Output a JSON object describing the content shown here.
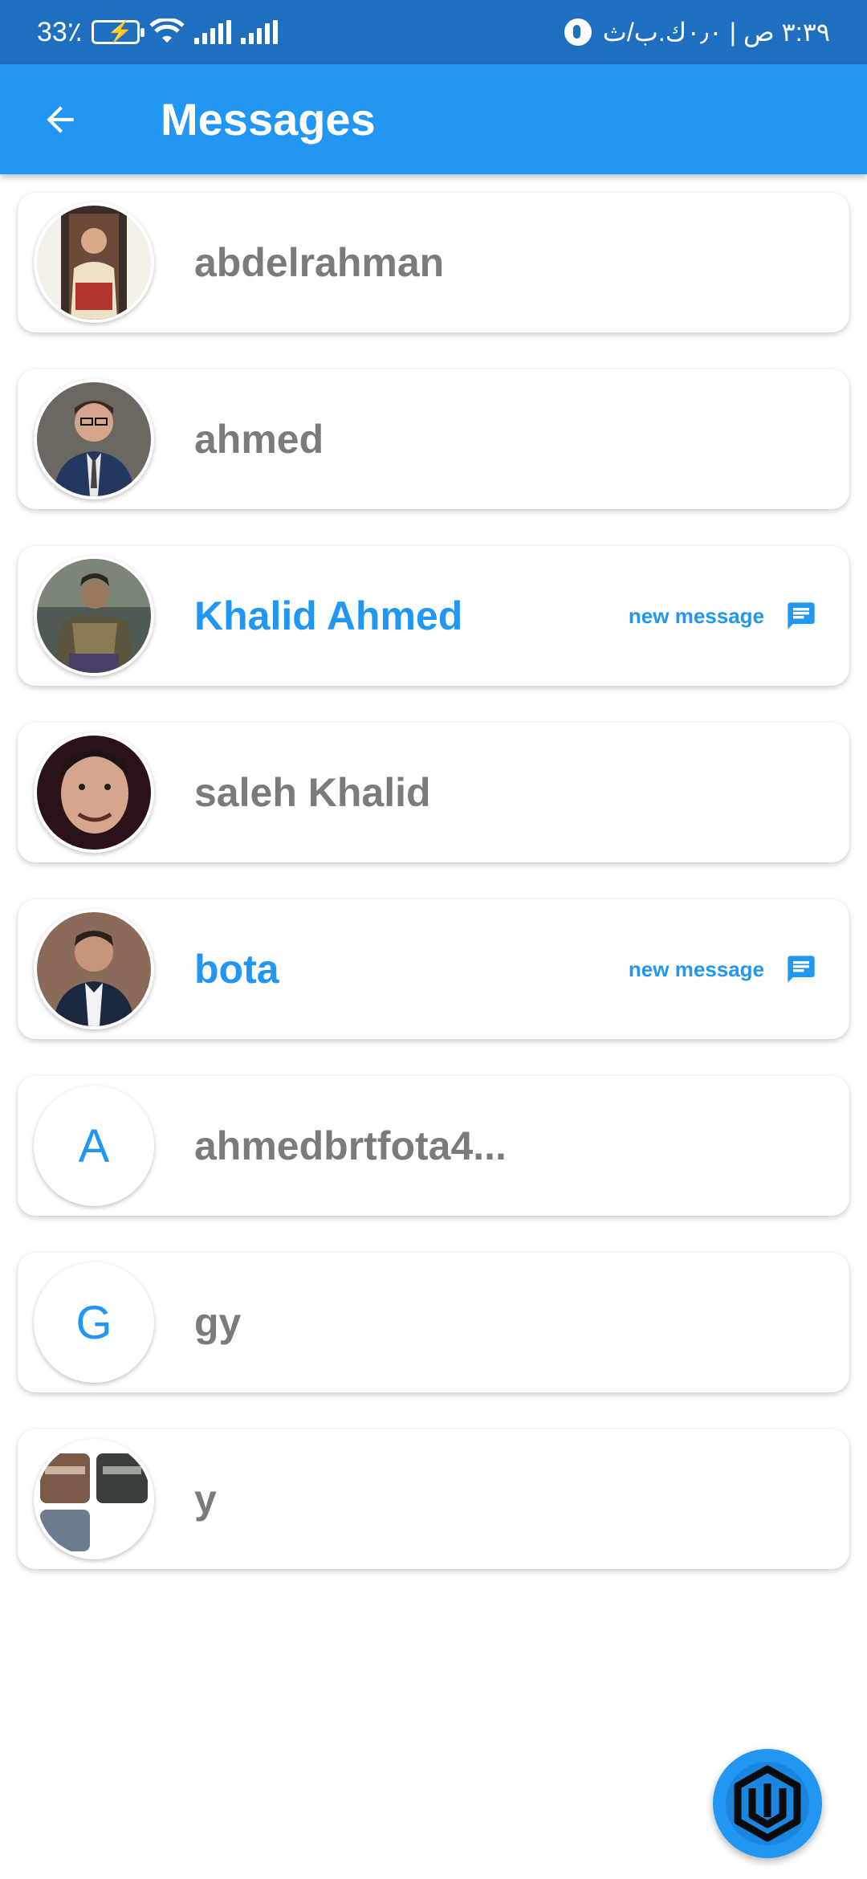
{
  "status_bar": {
    "battery_percent": "33٪",
    "time_text": "٣:٣٩ ص | ٠٫٠ك.ب/ث"
  },
  "app_bar": {
    "title": "Messages"
  },
  "conversations": [
    {
      "name": "abdelrahman",
      "avatar_letter": "",
      "new_message": false
    },
    {
      "name": "ahmed",
      "avatar_letter": "",
      "new_message": false
    },
    {
      "name": "Khalid Ahmed",
      "avatar_letter": "",
      "new_message": true,
      "badge_label": "new message"
    },
    {
      "name": "saleh Khalid",
      "avatar_letter": "",
      "new_message": false
    },
    {
      "name": "bota",
      "avatar_letter": "",
      "new_message": true,
      "badge_label": "new message"
    },
    {
      "name": "ahmedbrtfota4...",
      "avatar_letter": "A",
      "new_message": false
    },
    {
      "name": "gy",
      "avatar_letter": "G",
      "new_message": false
    },
    {
      "name": "y",
      "avatar_letter": "",
      "new_message": false
    }
  ],
  "colors": {
    "primary": "#2196f3",
    "status_bar": "#1e6fbf",
    "read_name": "#7b7b7b"
  }
}
